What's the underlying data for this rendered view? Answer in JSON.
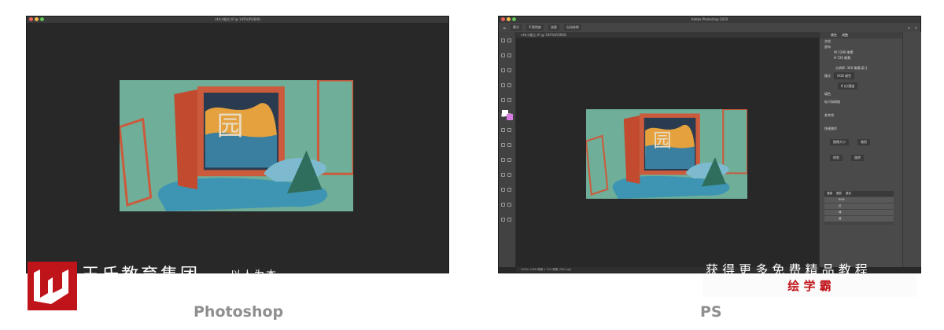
{
  "left_window": {
    "title": "c4d小橱立.tif @ 145%(RGB/8)",
    "brand_name": "王氏教育集团",
    "brand_slogan": "以人为本",
    "brand_logo": "W",
    "caption": "Photoshop"
  },
  "right_window": {
    "app_title": "Adobe Photoshop 2020",
    "options": [
      "模式",
      "不透明度",
      "流量",
      "自动抹除"
    ],
    "doc_tab": "c4d小橱立.tif @ 100%(RGB/8)",
    "properties": {
      "tabs": [
        "属性",
        "调整"
      ],
      "doc": "文档",
      "canvas": "画布",
      "width": "W 1280 像素",
      "height": "H 720 像素",
      "resolution": "分辨率: 300 像素/英寸",
      "mode_label": "模式",
      "mode": "RGB 颜色",
      "depth": "8 位/通道",
      "fill_label": "填色",
      "rulers": "标尺和网格",
      "guides": "参考线",
      "quick_actions": "快速操作",
      "buttons": [
        "图像大小",
        "裁剪",
        "修剪",
        "旋转"
      ]
    },
    "layers": {
      "tabs": [
        "通道",
        "图层",
        "路径"
      ],
      "items": [
        "RGB",
        "红",
        "绿",
        "蓝"
      ]
    },
    "status": "100%   1280 像素 x 720 像素 (300 ppi)",
    "promo": "获 得 更 多 免 费 精 品 教 程",
    "promo_brand": "绘 学 霸",
    "caption": "PS"
  },
  "colors": {
    "brand_red": "#c0141b",
    "canvas_teal": "#6fae98",
    "frame_orange": "#cc5a3c",
    "platform_blue": "#3e95b3"
  }
}
